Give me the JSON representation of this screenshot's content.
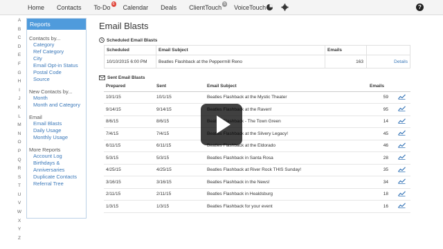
{
  "topnav": {
    "items": [
      "Home",
      "Contacts",
      "To-Do",
      "Calendar",
      "Deals",
      "ClientTouch",
      "VoiceTouch"
    ],
    "todo_badge": "6",
    "clienttouch_badge": "5",
    "help_label": "?"
  },
  "alphabet": [
    "A",
    "B",
    "C",
    "D",
    "E",
    "F",
    "G",
    "H",
    "I",
    "J",
    "K",
    "L",
    "M",
    "N",
    "O",
    "P",
    "Q",
    "R",
    "S",
    "T",
    "U",
    "V",
    "W",
    "X",
    "Y",
    "Z"
  ],
  "sidebar": {
    "title": "Reports",
    "sections": [
      {
        "title": "Contacts by...",
        "links": [
          "Category",
          "Ref Category",
          "City",
          "Email Opt-in Status",
          "Postal Code",
          "Source"
        ]
      },
      {
        "title": "New Contacts by...",
        "links": [
          "Month",
          "Month and Category"
        ]
      },
      {
        "title": "Email",
        "links": [
          "Email Blasts",
          "Daily Usage",
          "Monthly Usage"
        ]
      },
      {
        "title": "More Reports",
        "links": [
          "Account Log",
          "Birthdays & Anniversaries",
          "Duplicate Contacts",
          "Referral Tree"
        ]
      }
    ]
  },
  "main": {
    "title": "Email Blasts",
    "scheduled": {
      "heading": "Scheduled Email Blasts",
      "headers": [
        "Scheduled",
        "Email Subject",
        "Emails",
        ""
      ],
      "rows": [
        {
          "scheduled": "10/10/2015 6:00 PM",
          "subject": "Beatles Flashback at the Peppermill Reno",
          "emails": "163",
          "action": "Details"
        }
      ]
    },
    "sent": {
      "heading": "Sent Email Blasts",
      "headers": [
        "Prepared",
        "Sent",
        "Email Subject",
        "Emails",
        ""
      ],
      "rows": [
        {
          "prepared": "10/1/15",
          "sent": "10/1/15",
          "subject": "Beatles Flashback at the Mystic Theater",
          "emails": "59"
        },
        {
          "prepared": "9/14/15",
          "sent": "9/14/15",
          "subject": "Beatles Flashback at the Raven!",
          "emails": "95"
        },
        {
          "prepared": "8/6/15",
          "sent": "8/6/15",
          "subject": "Beatles Flashback - The Town Green",
          "emails": "14"
        },
        {
          "prepared": "7/4/15",
          "sent": "7/4/15",
          "subject": "Beatles Flashback at the Silvery Legacy!",
          "emails": "45"
        },
        {
          "prepared": "6/11/15",
          "sent": "6/11/15",
          "subject": "Beatles Flashback at the Eldorado",
          "emails": "46"
        },
        {
          "prepared": "5/3/15",
          "sent": "5/3/15",
          "subject": "Beatles Flashback in Santa Rosa",
          "emails": "28"
        },
        {
          "prepared": "4/25/15",
          "sent": "4/25/15",
          "subject": "Beatles Flashback at River Rock THIS Sunday!",
          "emails": "35"
        },
        {
          "prepared": "3/16/15",
          "sent": "3/16/15",
          "subject": "Beatles Flashback in the News!",
          "emails": "34"
        },
        {
          "prepared": "2/11/15",
          "sent": "2/11/15",
          "subject": "Beatles Flashback in Healdsburg",
          "emails": "18"
        },
        {
          "prepared": "1/3/15",
          "sent": "1/3/15",
          "subject": "Beatles Flashback for your event",
          "emails": "16"
        }
      ]
    }
  },
  "colors": {
    "accent": "#4f9bdc",
    "link": "#3a78b9",
    "badge": "#e04a3f"
  },
  "icons": {
    "trend": "trend-chart-icon",
    "pie": "pie-chart-icon",
    "gear": "gear-icon",
    "help": "help-icon",
    "play": "play-icon"
  }
}
